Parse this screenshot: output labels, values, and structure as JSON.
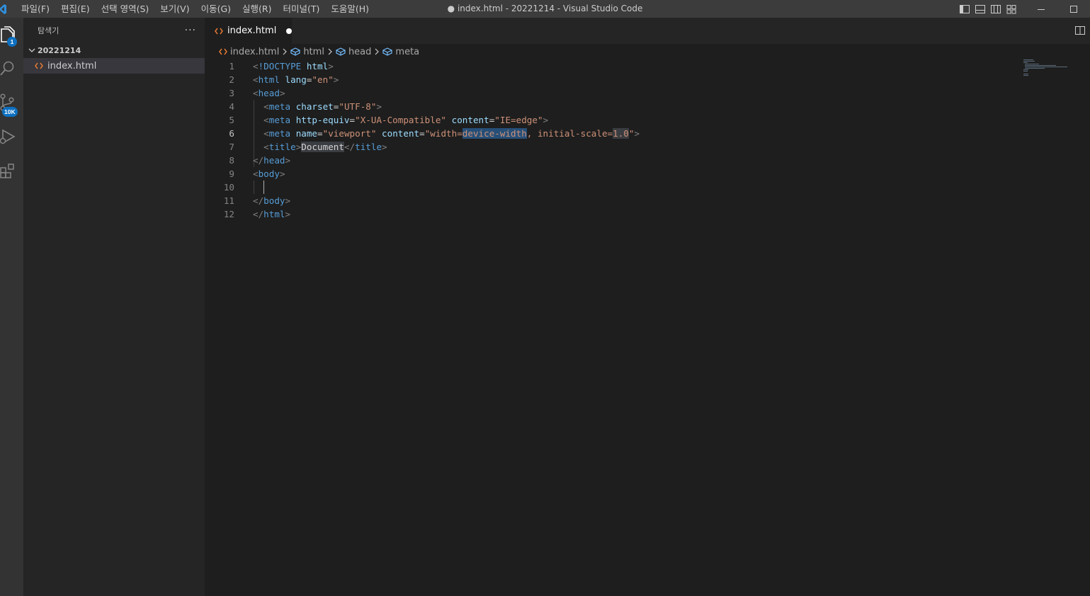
{
  "titlebar": {
    "menu": [
      "파일(F)",
      "편집(E)",
      "선택 영역(S)",
      "보기(V)",
      "이동(G)",
      "실행(R)",
      "터미널(T)",
      "도움말(H)"
    ],
    "window_title": "● index.html - 20221214 - Visual Studio Code"
  },
  "activitybar": {
    "explorer_badge": "1",
    "scm_badge": "10K"
  },
  "sidebar": {
    "title": "탐색기",
    "more": "···",
    "folder": "20221214",
    "file": "index.html"
  },
  "editor": {
    "tab_label": "index.html",
    "breadcrumb": [
      "index.html",
      "html",
      "head",
      "meta"
    ],
    "active_line": 6,
    "lines": [
      {
        "n": "1",
        "tokens": [
          [
            "b",
            "<"
          ],
          [
            "t",
            "!DOCTYPE "
          ],
          [
            "a",
            "html"
          ],
          [
            "b",
            ">"
          ]
        ]
      },
      {
        "n": "2",
        "tokens": [
          [
            "b",
            "<"
          ],
          [
            "t",
            "html "
          ],
          [
            "a",
            "lang"
          ],
          [
            "p",
            "="
          ],
          [
            "s",
            "\"en\""
          ],
          [
            "b",
            ">"
          ]
        ]
      },
      {
        "n": "3",
        "tokens": [
          [
            "b",
            "<"
          ],
          [
            "t",
            "head"
          ],
          [
            "b",
            ">"
          ]
        ]
      },
      {
        "n": "4",
        "tokens": [
          [
            "p",
            "  "
          ],
          [
            "b",
            "<"
          ],
          [
            "t",
            "meta "
          ],
          [
            "a",
            "charset"
          ],
          [
            "p",
            "="
          ],
          [
            "s",
            "\"UTF-8\""
          ],
          [
            "b",
            ">"
          ]
        ]
      },
      {
        "n": "5",
        "tokens": [
          [
            "p",
            "  "
          ],
          [
            "b",
            "<"
          ],
          [
            "t",
            "meta "
          ],
          [
            "a",
            "http-equiv"
          ],
          [
            "p",
            "="
          ],
          [
            "s",
            "\"X-UA-Compatible\""
          ],
          [
            "p",
            " "
          ],
          [
            "a",
            "content"
          ],
          [
            "p",
            "="
          ],
          [
            "s",
            "\"IE=edge\""
          ],
          [
            "b",
            ">"
          ]
        ]
      },
      {
        "n": "6",
        "tokens": [
          [
            "p",
            "  "
          ],
          [
            "b",
            "<"
          ],
          [
            "t",
            "meta "
          ],
          [
            "a",
            "name"
          ],
          [
            "p",
            "="
          ],
          [
            "s",
            "\"viewport\""
          ],
          [
            "p",
            " "
          ],
          [
            "a",
            "content"
          ],
          [
            "p",
            "="
          ],
          [
            "s",
            "\"width="
          ],
          [
            "s hl",
            "device-width"
          ],
          [
            "s",
            ", initial-scale="
          ],
          [
            "s hl2",
            "1.0"
          ],
          [
            "s",
            "\""
          ],
          [
            "b",
            ">"
          ]
        ]
      },
      {
        "n": "7",
        "tokens": [
          [
            "p",
            "  "
          ],
          [
            "b",
            "<"
          ],
          [
            "t",
            "title"
          ],
          [
            "b",
            ">"
          ],
          [
            "p hl2",
            "Document"
          ],
          [
            "b",
            "</"
          ],
          [
            "t",
            "title"
          ],
          [
            "b",
            ">"
          ]
        ]
      },
      {
        "n": "8",
        "tokens": [
          [
            "b",
            "</"
          ],
          [
            "t",
            "head"
          ],
          [
            "b",
            ">"
          ]
        ]
      },
      {
        "n": "9",
        "tokens": [
          [
            "b",
            "<"
          ],
          [
            "t",
            "body"
          ],
          [
            "b",
            ">"
          ]
        ]
      },
      {
        "n": "10",
        "tokens": [
          [
            "p",
            "  "
          ]
        ]
      },
      {
        "n": "11",
        "tokens": [
          [
            "b",
            "</"
          ],
          [
            "t",
            "body"
          ],
          [
            "b",
            ">"
          ]
        ]
      },
      {
        "n": "12",
        "tokens": [
          [
            "b",
            "</"
          ],
          [
            "t",
            "html"
          ],
          [
            "b",
            ">"
          ]
        ]
      }
    ]
  },
  "colors": {
    "accent": "#0e70c0",
    "tag": "#569cd6",
    "attribute": "#9cdcfe",
    "string": "#ce9178",
    "html_icon": "#e37933"
  }
}
